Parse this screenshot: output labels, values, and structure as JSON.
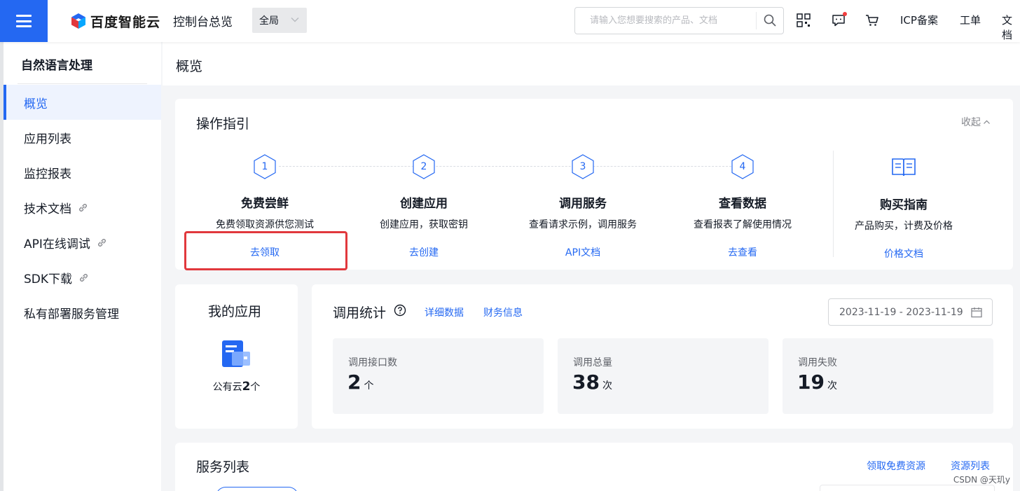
{
  "topbar": {
    "logo_text": "百度智能云",
    "console_title": "控制台总览",
    "scope": "全局",
    "search_placeholder": "请输入您想要搜索的产品、文档",
    "links": [
      "ICP备案",
      "工单",
      "文档"
    ]
  },
  "sidebar": {
    "title": "自然语言处理",
    "items": [
      {
        "label": "概览",
        "active": true,
        "external": false
      },
      {
        "label": "应用列表",
        "active": false,
        "external": false
      },
      {
        "label": "监控报表",
        "active": false,
        "external": false
      },
      {
        "label": "技术文档",
        "active": false,
        "external": true
      },
      {
        "label": "API在线调试",
        "active": false,
        "external": true
      },
      {
        "label": "SDK下载",
        "active": false,
        "external": true
      },
      {
        "label": "私有部署服务管理",
        "active": false,
        "external": false
      }
    ]
  },
  "page": {
    "title": "概览"
  },
  "guide": {
    "title": "操作指引",
    "collapse_label": "收起",
    "steps": [
      {
        "num": "1",
        "title": "免费尝鲜",
        "desc": "免费领取资源供您测试",
        "link": "去领取"
      },
      {
        "num": "2",
        "title": "创建应用",
        "desc": "创建应用，获取密钥",
        "link": "去创建"
      },
      {
        "num": "3",
        "title": "调用服务",
        "desc": "查看请求示例，调用服务",
        "link": "API文档"
      },
      {
        "num": "4",
        "title": "查看数据",
        "desc": "查看报表了解使用情况",
        "link": "去查看"
      }
    ],
    "purchase": {
      "title": "购买指南",
      "desc": "产品购买，计费及价格",
      "link": "价格文档"
    }
  },
  "my_app": {
    "title": "我的应用",
    "count_prefix": "公有云",
    "count": "2",
    "count_suffix": "个"
  },
  "stats": {
    "title": "调用统计",
    "links": [
      "详细数据",
      "财务信息"
    ],
    "date_range": "2023-11-19 - 2023-11-19",
    "boxes": [
      {
        "label": "调用接口数",
        "value": "2",
        "unit": "个"
      },
      {
        "label": "调用总量",
        "value": "38",
        "unit": "次"
      },
      {
        "label": "调用失败",
        "value": "19",
        "unit": "次"
      }
    ]
  },
  "services": {
    "title": "服务列表",
    "links": [
      "领取免费资源",
      "资源列表"
    ]
  },
  "watermark": "CSDN @天玑y",
  "colors": {
    "brand": "#2468f2",
    "highlight": "#e1383d",
    "alert_dot": "#f33e3e"
  }
}
